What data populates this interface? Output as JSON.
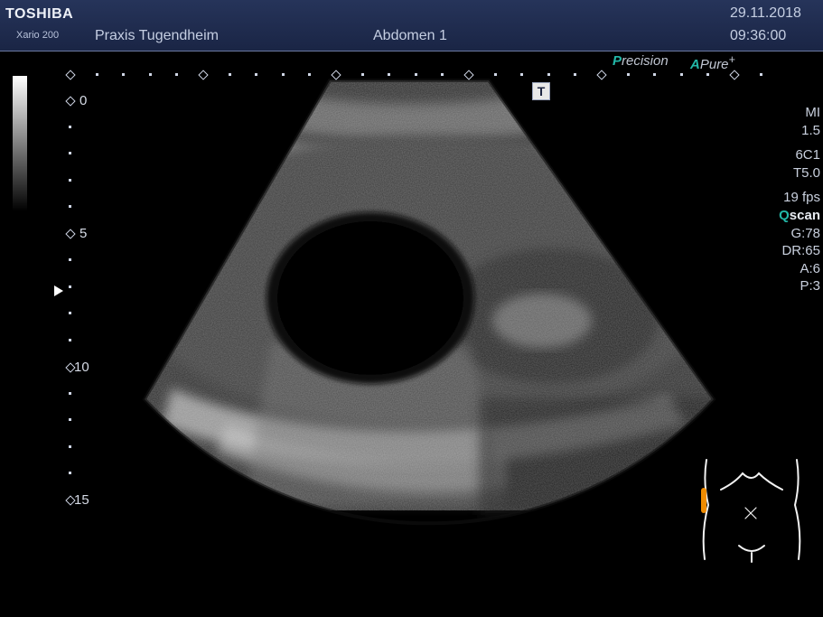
{
  "header": {
    "brand": "TOSHIBA",
    "model": "Xario 200",
    "hospital": "Praxis Tugendheim",
    "preset": "Abdomen 1",
    "date": "29.11.2018",
    "time": "09:36:00"
  },
  "features": {
    "precision_k": "P",
    "precision_rest": "recision",
    "apure_k": "A",
    "apure_rest": "Pure",
    "apure_plus": "+"
  },
  "depth_scale": {
    "labels": [
      "0",
      "5",
      "10",
      "15"
    ],
    "unit": "cm"
  },
  "transducer_marker": "T",
  "parameters": {
    "mi_label": "MI",
    "mi_value": "1.5",
    "probe": "6C1",
    "thi": "T5.0",
    "frame_rate": "19 fps",
    "qscan_k": "Q",
    "qscan_rest": "scan",
    "gain": "G:78",
    "dynamic_range": "DR:65",
    "a": "A:6",
    "p": "P:3"
  },
  "colors": {
    "header_bg": "#1f2b4d",
    "accent_teal": "#22b8a8",
    "probe_marker": "#f08c00"
  },
  "icons": [
    "grayscale-bar",
    "focus-arrow-icon",
    "body-mark-icon",
    "probe-position-icon"
  ]
}
